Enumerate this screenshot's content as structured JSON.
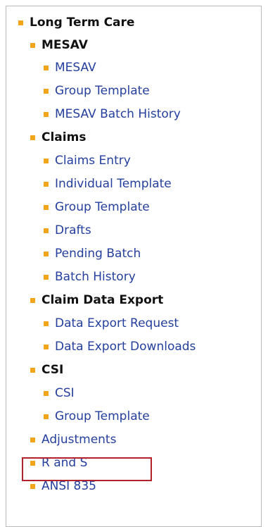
{
  "menu": {
    "long_term_care": "Long Term Care",
    "mesav_header": "MESAV",
    "mesav": "MESAV",
    "mesav_group_template": "Group Template",
    "mesav_batch_history": "MESAV Batch History",
    "claims_header": "Claims",
    "claims_entry": "Claims Entry",
    "individual_template": "Individual Template",
    "claims_group_template": "Group Template",
    "drafts": "Drafts",
    "pending_batch": "Pending Batch",
    "batch_history": "Batch History",
    "claim_data_export_header": "Claim Data Export",
    "data_export_request": "Data Export Request",
    "data_export_downloads": "Data Export Downloads",
    "csi_header": "CSI",
    "csi": "CSI",
    "csi_group_template": "Group Template",
    "adjustments": "Adjustments",
    "r_and_s": "R and S",
    "ansi_835": "ANSI 835"
  },
  "colors": {
    "bullet": "#f2a51a",
    "link": "#243f9d",
    "header": "#111111",
    "highlight_border": "#b3222a",
    "panel_border": "#b9b9b9"
  }
}
